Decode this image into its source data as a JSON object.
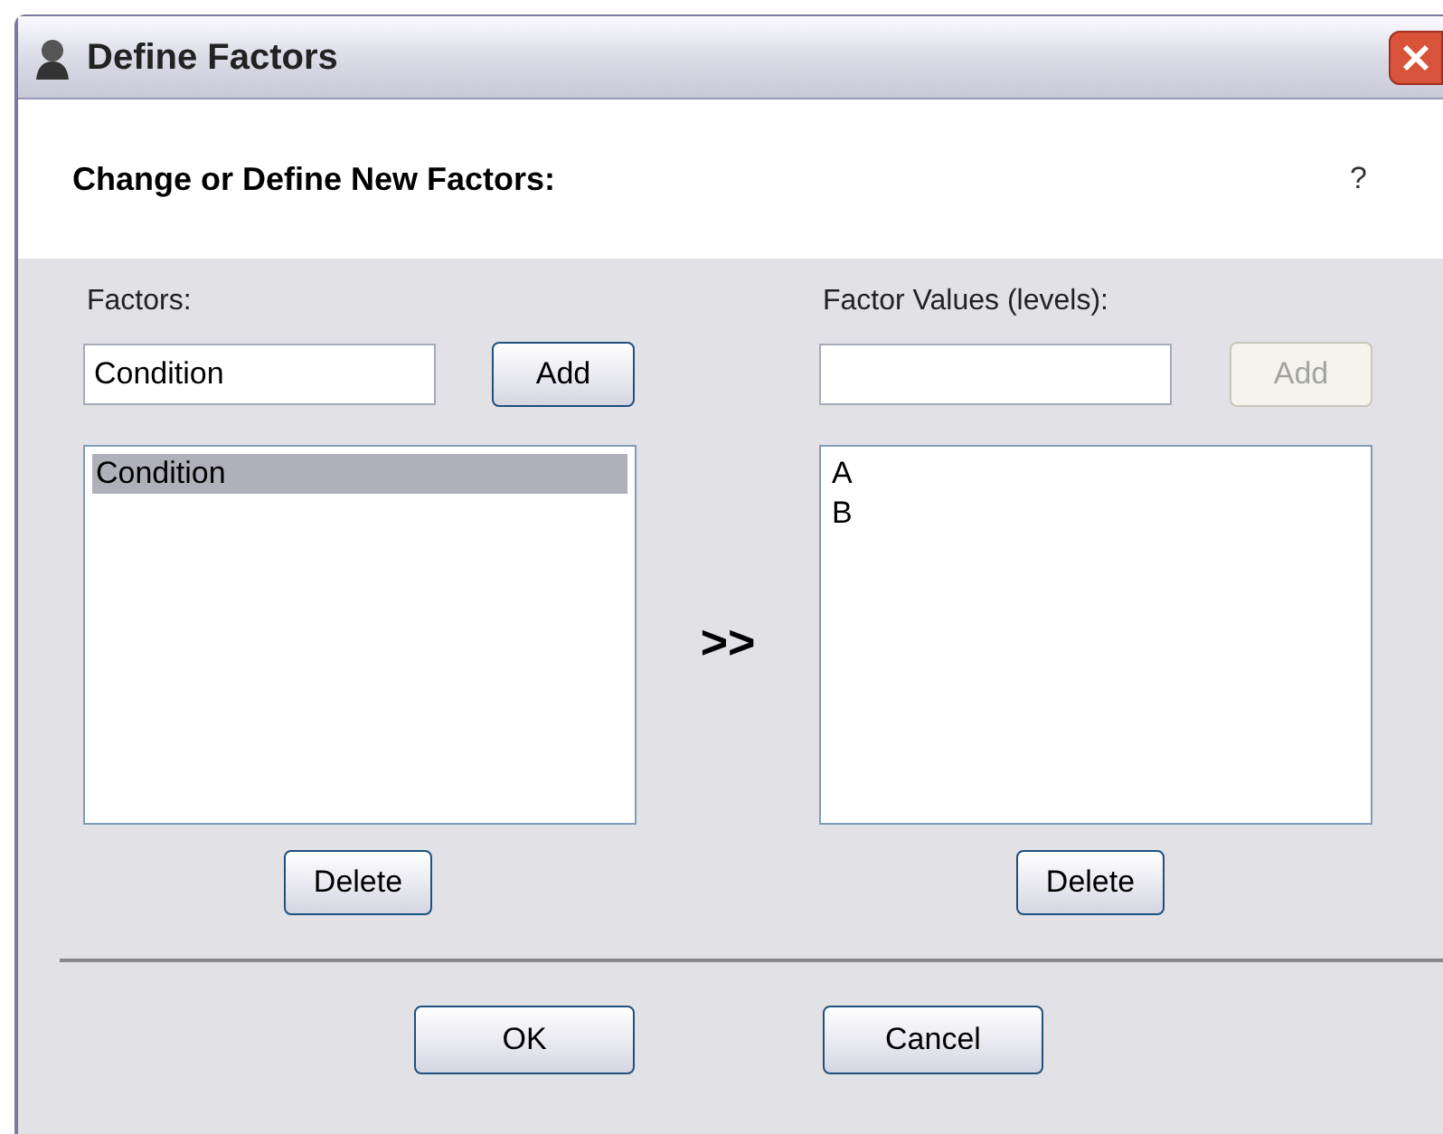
{
  "window": {
    "title": "Define Factors"
  },
  "header": {
    "heading": "Change or Define New Factors:",
    "help": "?"
  },
  "panels": [
    {
      "label": "Factors:",
      "input_value": "Condition",
      "add_button": {
        "label": "Add",
        "disabled": false
      },
      "items": [
        {
          "text": "Condition",
          "selected": true
        }
      ],
      "delete_button": {
        "label": "Delete",
        "disabled": false
      }
    },
    {
      "label": "Factor Values (levels):",
      "add_button": {
        "label": "Add",
        "disabled": true
      },
      "items": [
        {
          "text": "A",
          "selected": false
        },
        {
          "text": "B",
          "selected": false
        }
      ],
      "delete_button": {
        "label": "Delete",
        "disabled": false
      }
    }
  ],
  "transfer": ">>",
  "buttons": [
    {
      "label": "OK"
    },
    {
      "label": "Cancel"
    }
  ]
}
